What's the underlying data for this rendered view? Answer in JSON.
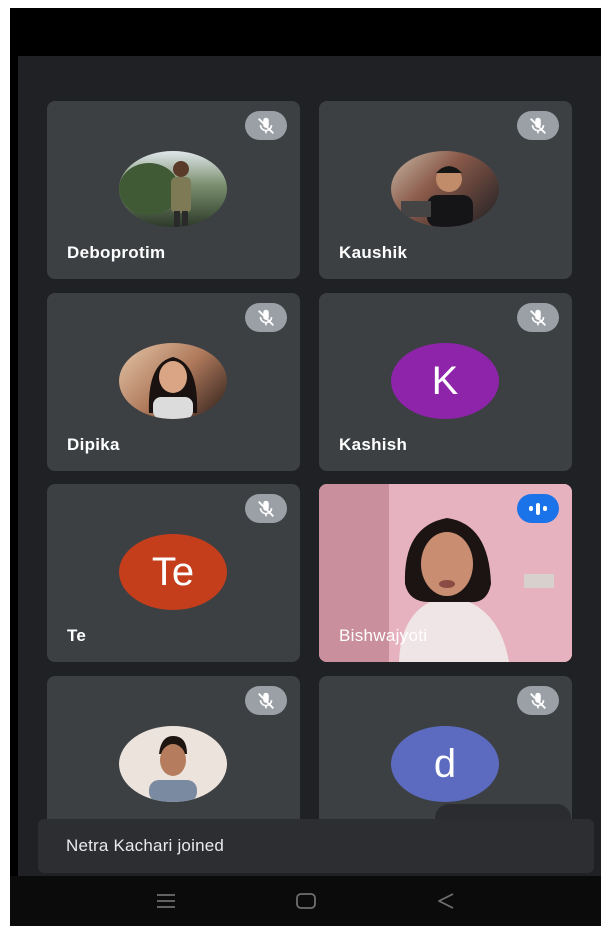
{
  "participants": [
    {
      "name": "Deboprotim",
      "avatar_type": "photo",
      "muted": true,
      "colors": [
        "#7a8f6e",
        "#2d3a2a"
      ]
    },
    {
      "name": "Kaushik",
      "avatar_type": "photo",
      "muted": true,
      "colors": [
        "#b5a89a",
        "#1e1e22"
      ]
    },
    {
      "name": "Dipika",
      "avatar_type": "photo",
      "muted": true,
      "colors": [
        "#caa58a",
        "#2a1c18"
      ]
    },
    {
      "name": "Kashish",
      "avatar_type": "letter",
      "letter": "K",
      "avatar_color": "#8e24aa",
      "muted": true
    },
    {
      "name": "Te",
      "avatar_type": "letter",
      "letter": "Te",
      "avatar_color": "#c43e1c",
      "muted": true
    },
    {
      "name": "Bishwajyoti",
      "avatar_type": "video",
      "muted": false,
      "speaking": true
    },
    {
      "name": "",
      "avatar_type": "photo",
      "muted": true,
      "colors": [
        "#e7d2c4",
        "#3b2b22"
      ]
    },
    {
      "name": "",
      "avatar_type": "letter",
      "letter": "d",
      "avatar_color": "#5c6bc0",
      "muted": true
    }
  ],
  "toast": {
    "text": "Netra Kachari joined"
  },
  "icons": {
    "mute": "mic-off-icon",
    "speaking": "audio-level-icon",
    "nav_menu": "recent-apps-icon",
    "nav_home": "home-icon",
    "nav_back": "back-icon"
  },
  "colors": {
    "tile_bg": "#3c4043",
    "page_bg": "#202124",
    "speaking_badge": "#1a73e8"
  }
}
